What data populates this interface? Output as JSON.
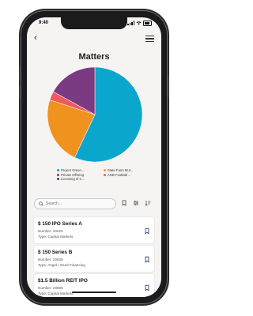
{
  "status_bar": {
    "time": "9:40"
  },
  "page": {
    "title": "Matters"
  },
  "chart_data": {
    "type": "pie",
    "title": "",
    "slices": [
      {
        "label": "Project Green ...",
        "value": 57,
        "color": "#0aa6cc"
      },
      {
        "label": "State Farm Mut...",
        "value": 0,
        "color": "#f39c1f"
      },
      {
        "label": "Private Offering",
        "value": 23,
        "color": "#f0921e"
      },
      {
        "label": "AGB Football ...",
        "value": 3,
        "color": "#f05a5a"
      },
      {
        "label": "Licensing of C...",
        "value": 17,
        "color": "#7a3b83"
      }
    ]
  },
  "legend": {
    "items": [
      {
        "label": "Project Green ...",
        "color": "#0aa6cc"
      },
      {
        "label": "State Farm Mut...",
        "color": "#f39c1f"
      },
      {
        "label": "Private Offering",
        "color": "#7a3b83"
      },
      {
        "label": "AGB Football ...",
        "color": "#f05a5a"
      },
      {
        "label": "Licensing of C...",
        "color": "#5a2a64"
      }
    ]
  },
  "search": {
    "placeholder": "Search..."
  },
  "matters": [
    {
      "title": "$ 150 IPO Series A",
      "number": "Number: 20025",
      "type": "Type: Capital Markets"
    },
    {
      "title": "$ 150 Series B",
      "number": "Number: 20026",
      "type": "Type: Angel / Seed Financing"
    },
    {
      "title": "$1.5 Billion REIT IPO",
      "number": "Number: 20005",
      "type": "Type: Capital Markets"
    }
  ],
  "colors": {
    "accent": "#1f3a5f",
    "background": "#f6f4f2"
  }
}
